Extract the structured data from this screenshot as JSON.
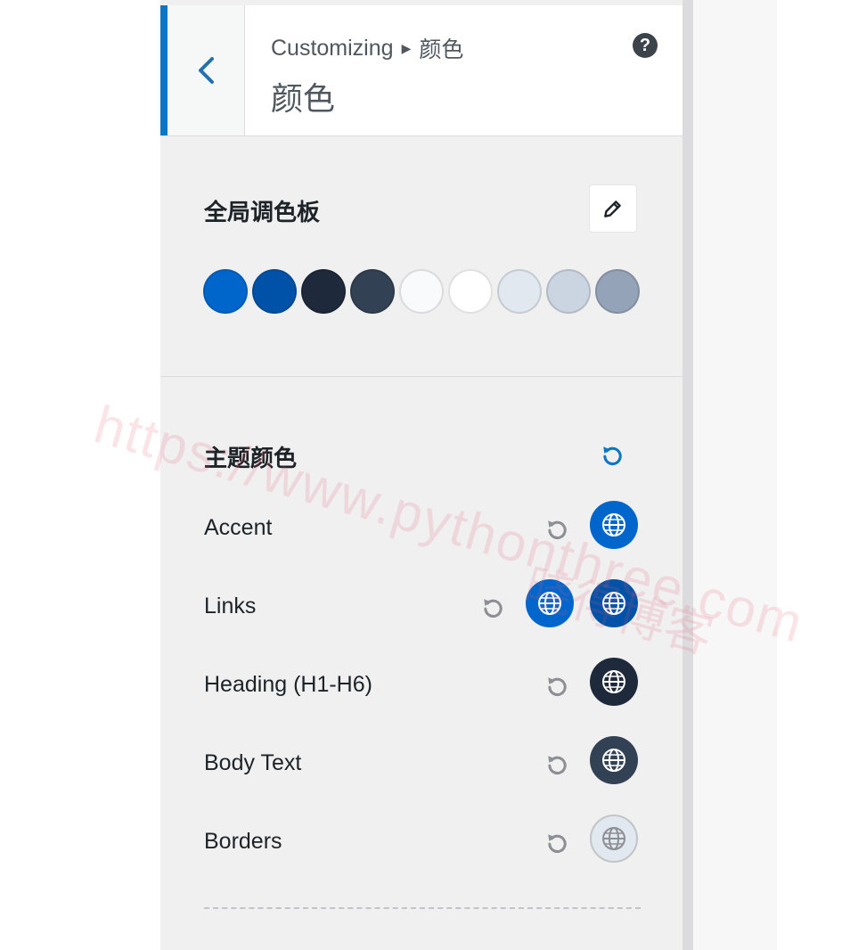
{
  "header": {
    "breadcrumb_root": "Customizing",
    "breadcrumb_current": "颜色",
    "title": "颜色",
    "help_symbol": "?"
  },
  "global_palette": {
    "title": "全局调色板",
    "swatches": [
      "#0066cc",
      "#0052a8",
      "#1e293b",
      "#334155",
      "#f8fafc",
      "#ffffff",
      "#e2e8f0",
      "#cbd5e1",
      "#94a3b8"
    ]
  },
  "theme_colors": {
    "title": "主题颜色",
    "rows": [
      {
        "label": "Accent",
        "colors": [
          "#0066cc"
        ]
      },
      {
        "label": "Links",
        "colors": [
          "#0066cc",
          "#0052a8"
        ]
      },
      {
        "label": "Heading (H1-H6)",
        "colors": [
          "#1e293b"
        ]
      },
      {
        "label": "Body Text",
        "colors": [
          "#334155"
        ]
      },
      {
        "label": "Borders",
        "colors": [
          "#e2e8f0"
        ]
      }
    ]
  },
  "watermark": {
    "url": "https://www.pythonthree.com",
    "name": "晓得博客"
  },
  "colors": {
    "accent": "#0a76c4",
    "back_chevron": "#2271b1",
    "reset_active": "#0a76c4",
    "reset_inactive": "#8c8f94"
  }
}
